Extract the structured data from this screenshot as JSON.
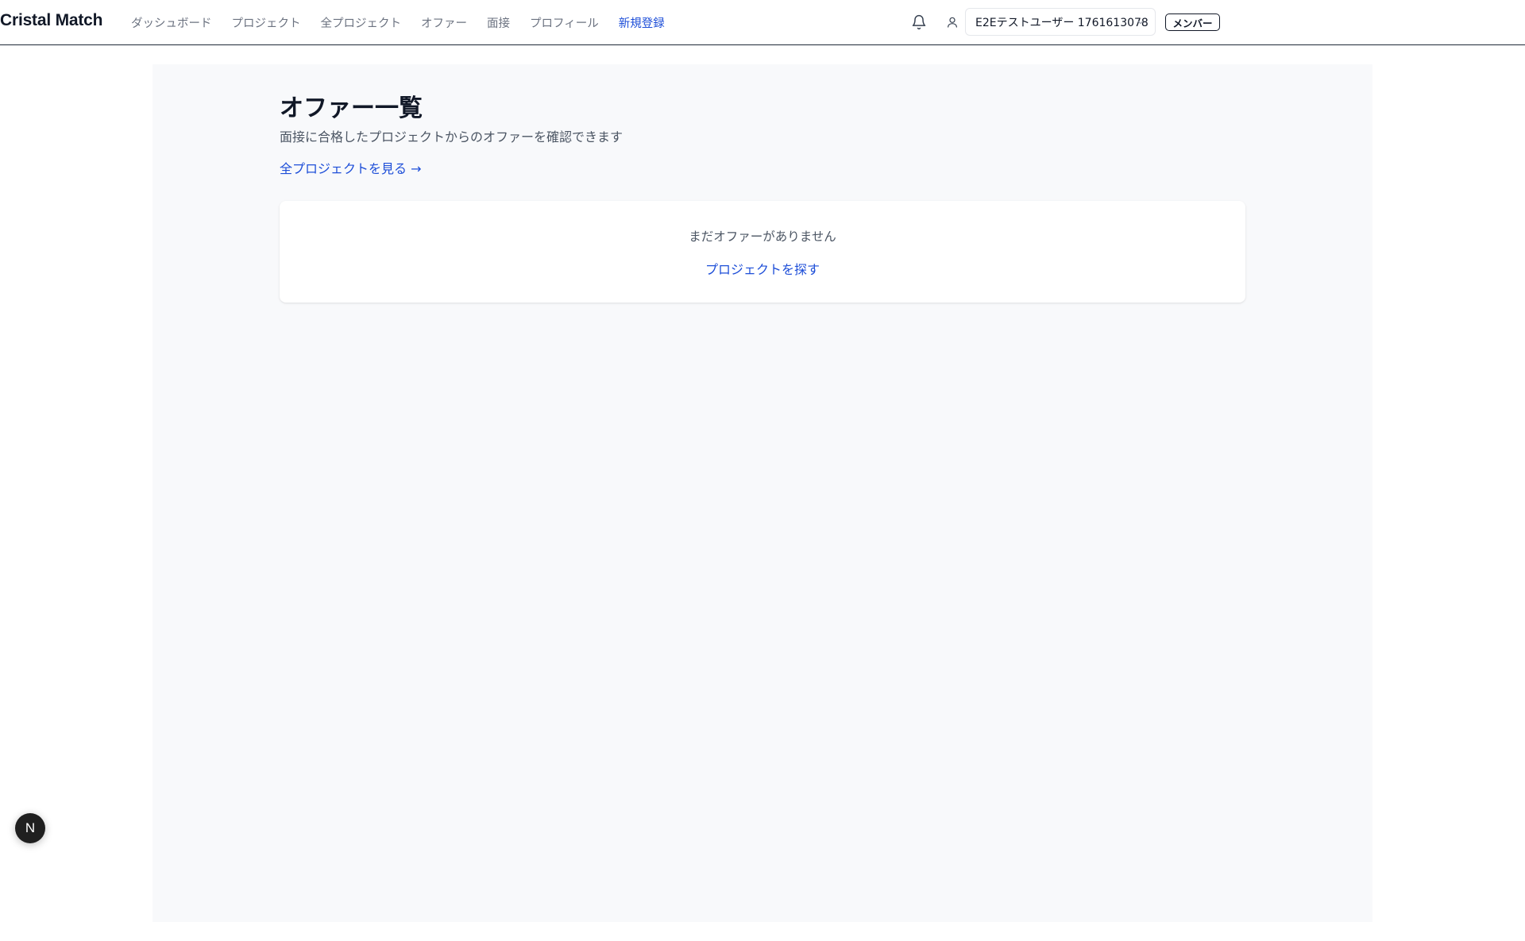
{
  "header": {
    "brand": "Cristal Match",
    "nav": [
      {
        "label": "ダッシュボード",
        "active": false
      },
      {
        "label": "プロジェクト",
        "active": false
      },
      {
        "label": "全プロジェクト",
        "active": false
      },
      {
        "label": "オファー",
        "active": false
      },
      {
        "label": "面接",
        "active": false
      },
      {
        "label": "プロフィール",
        "active": false
      },
      {
        "label": "新規登録",
        "active": true
      }
    ],
    "user_select_value": "E2Eテストユーザー 1761613078",
    "role_badge": "メンバー",
    "icons": {
      "notifications": "bell-icon",
      "user": "user-icon",
      "dropdown": "chevron-down-icon"
    }
  },
  "main": {
    "title": "オファー一覧",
    "subtitle": "面接に合格したプロジェクトからのオファーを確認できます",
    "all_projects_link": "全プロジェクトを見る →",
    "empty_state": {
      "message": "まだオファーがありません",
      "link": "プロジェクトを探す"
    }
  },
  "dev_badge": "N",
  "colors": {
    "accent": "#1d4ed8",
    "text_primary": "#111827",
    "text_muted": "#6b7280",
    "page_background": "#f8f9fb",
    "card_background": "#ffffff"
  }
}
